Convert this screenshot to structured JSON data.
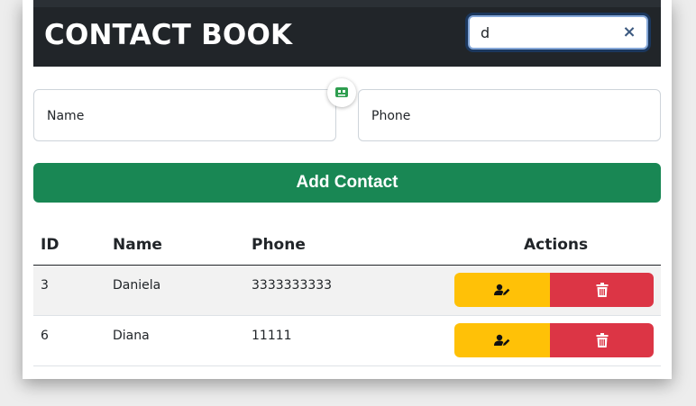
{
  "header": {
    "title": "CONTACT BOOK",
    "search_value": "d",
    "clear_icon": "×"
  },
  "form": {
    "name_placeholder": "Name",
    "phone_placeholder": "Phone",
    "add_label": "Add Contact"
  },
  "table": {
    "columns": [
      "ID",
      "Name",
      "Phone",
      "Actions"
    ],
    "rows": [
      {
        "id": "3",
        "name": "Daniela",
        "phone": "3333333333"
      },
      {
        "id": "6",
        "name": "Diana",
        "phone": "11111"
      }
    ],
    "edit_icon": "user-edit-icon",
    "delete_icon": "trash-icon"
  },
  "colors": {
    "header_bg": "#212529",
    "add_button": "#198754",
    "edit_button": "#ffc107",
    "delete_button": "#dc3545"
  }
}
